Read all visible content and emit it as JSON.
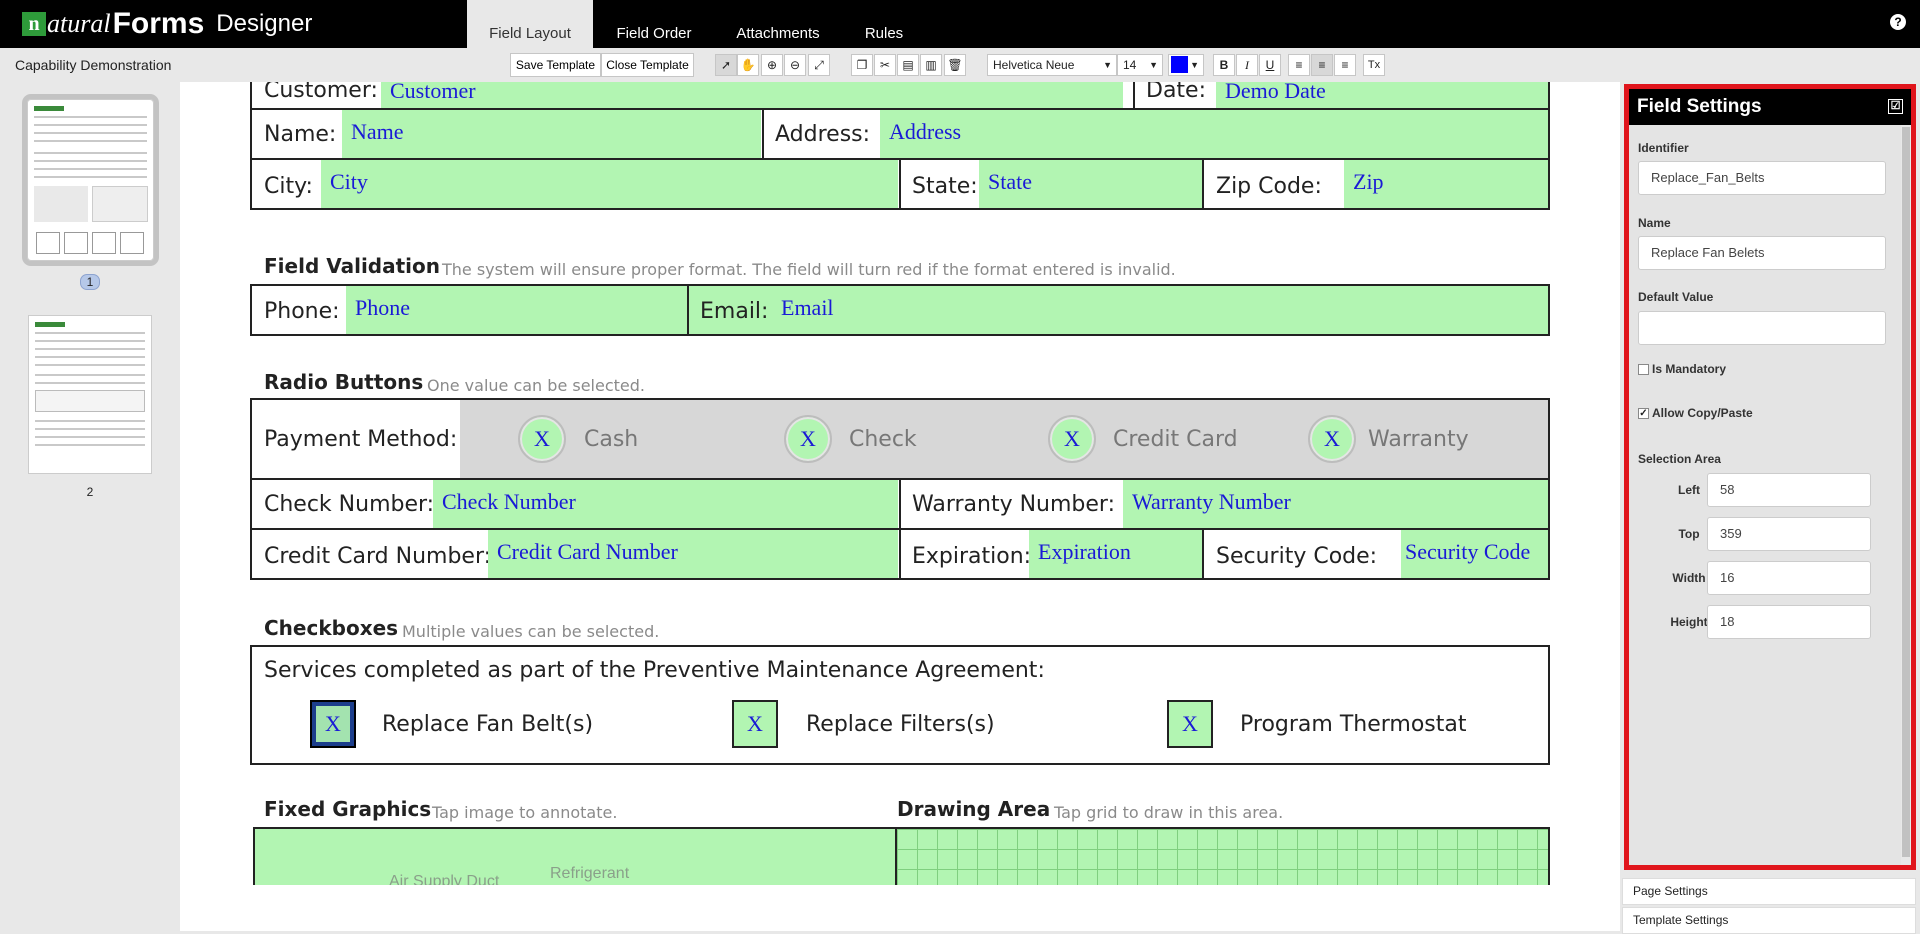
{
  "app": {
    "logo_n": "n",
    "logo_natural": "atural",
    "logo_forms": "Forms",
    "logo_designer": "Designer",
    "help": "?"
  },
  "tabs": [
    {
      "label": "Field Layout",
      "active": true
    },
    {
      "label": "Field Order",
      "active": false
    },
    {
      "label": "Attachments",
      "active": false
    },
    {
      "label": "Rules",
      "active": false
    }
  ],
  "toolbar": {
    "document_title": "Capability Demonstration",
    "save_template": "Save Template",
    "close_template": "Close Template",
    "font_family": "Helvetica Neue",
    "font_size": "14",
    "font_color": "#0000ff",
    "icons": [
      "pointer-icon",
      "hand-icon",
      "zoom-in-icon",
      "zoom-out-icon",
      "fit-icon",
      "copy-icon",
      "cut-icon",
      "paste-icon",
      "paste-special-icon",
      "trash-icon",
      "bold-icon",
      "italic-icon",
      "underline-icon",
      "align-left-icon",
      "align-center-icon",
      "align-right-icon",
      "clear-format-icon"
    ],
    "bold": "B",
    "italic": "I",
    "underline": "U",
    "clear": "Tx"
  },
  "pages": [
    {
      "number": "1",
      "selected": true
    },
    {
      "number": "2",
      "selected": false
    }
  ],
  "form": {
    "top_row": {
      "customer_label": "Customer:",
      "customer_value": "Customer",
      "date_label": "Date:",
      "date_value": "Demo Date"
    },
    "row_name": {
      "name_label": "Name:",
      "name_value": "Name",
      "address_label": "Address:",
      "address_value": "Address"
    },
    "row_city": {
      "city_label": "City:",
      "city_value": "City",
      "state_label": "State:",
      "state_value": "State",
      "zip_label": "Zip Code:",
      "zip_value": "Zip"
    },
    "validation": {
      "title": "Field Validation",
      "note": "The system will ensure proper format. The field will turn red if the format entered is invalid.",
      "phone_label": "Phone:",
      "phone_value": "Phone",
      "email_label": "Email:",
      "email_value": "Email"
    },
    "radio": {
      "title": "Radio Buttons",
      "note": "One value can be selected.",
      "payment_label": "Payment Method:",
      "mark": "X",
      "options": [
        "Cash",
        "Check",
        "Credit Card",
        "Warranty"
      ],
      "check_number_label": "Check Number:",
      "check_number_value": "Check Number",
      "warranty_number_label": "Warranty Number:",
      "warranty_number_value": "Warranty Number",
      "cc_label": "Credit Card Number:",
      "cc_value": "Credit Card Number",
      "exp_label": "Expiration:",
      "exp_value": "Expiration",
      "sec_label": "Security Code:",
      "sec_value": "Security Code"
    },
    "checkboxes": {
      "title": "Checkboxes",
      "note": "Multiple values can be selected.",
      "prompt": "Services completed as part of the Preventive Maintenance Agreement:",
      "mark": "X",
      "items": [
        "Replace Fan Belt(s)",
        "Replace Filters(s)",
        "Program Thermostat"
      ]
    },
    "graphics": {
      "title": "Fixed Graphics",
      "note": "Tap image to annotate.",
      "image_text_1": "Air Supply Duct",
      "image_text_2": "Refrigerant"
    },
    "drawing": {
      "title": "Drawing Area",
      "note": "Tap grid to draw in this area."
    }
  },
  "field_settings": {
    "title": "Field Settings",
    "identifier_label": "Identifier",
    "identifier_value": "Replace_Fan_Belts",
    "name_label": "Name",
    "name_value": "Replace Fan Belets",
    "default_label": "Default Value",
    "default_value": "",
    "mandatory_label": "Is Mandatory",
    "mandatory_checked": false,
    "copy_paste_label": "Allow Copy/Paste",
    "copy_paste_checked": true,
    "copy_paste_mark": "✓",
    "selection_area_label": "Selection Area",
    "left_label": "Left",
    "left_value": "58",
    "top_label": "Top",
    "top_value": "359",
    "width_label": "Width",
    "width_value": "16",
    "height_label": "Height",
    "height_value": "18",
    "highlight_color": "#e0151c"
  },
  "accordion": {
    "page_settings": "Page Settings",
    "template_settings": "Template Settings"
  },
  "colors": {
    "field_fill": "#b2f5b2",
    "field_text": "#1a1ad6"
  }
}
